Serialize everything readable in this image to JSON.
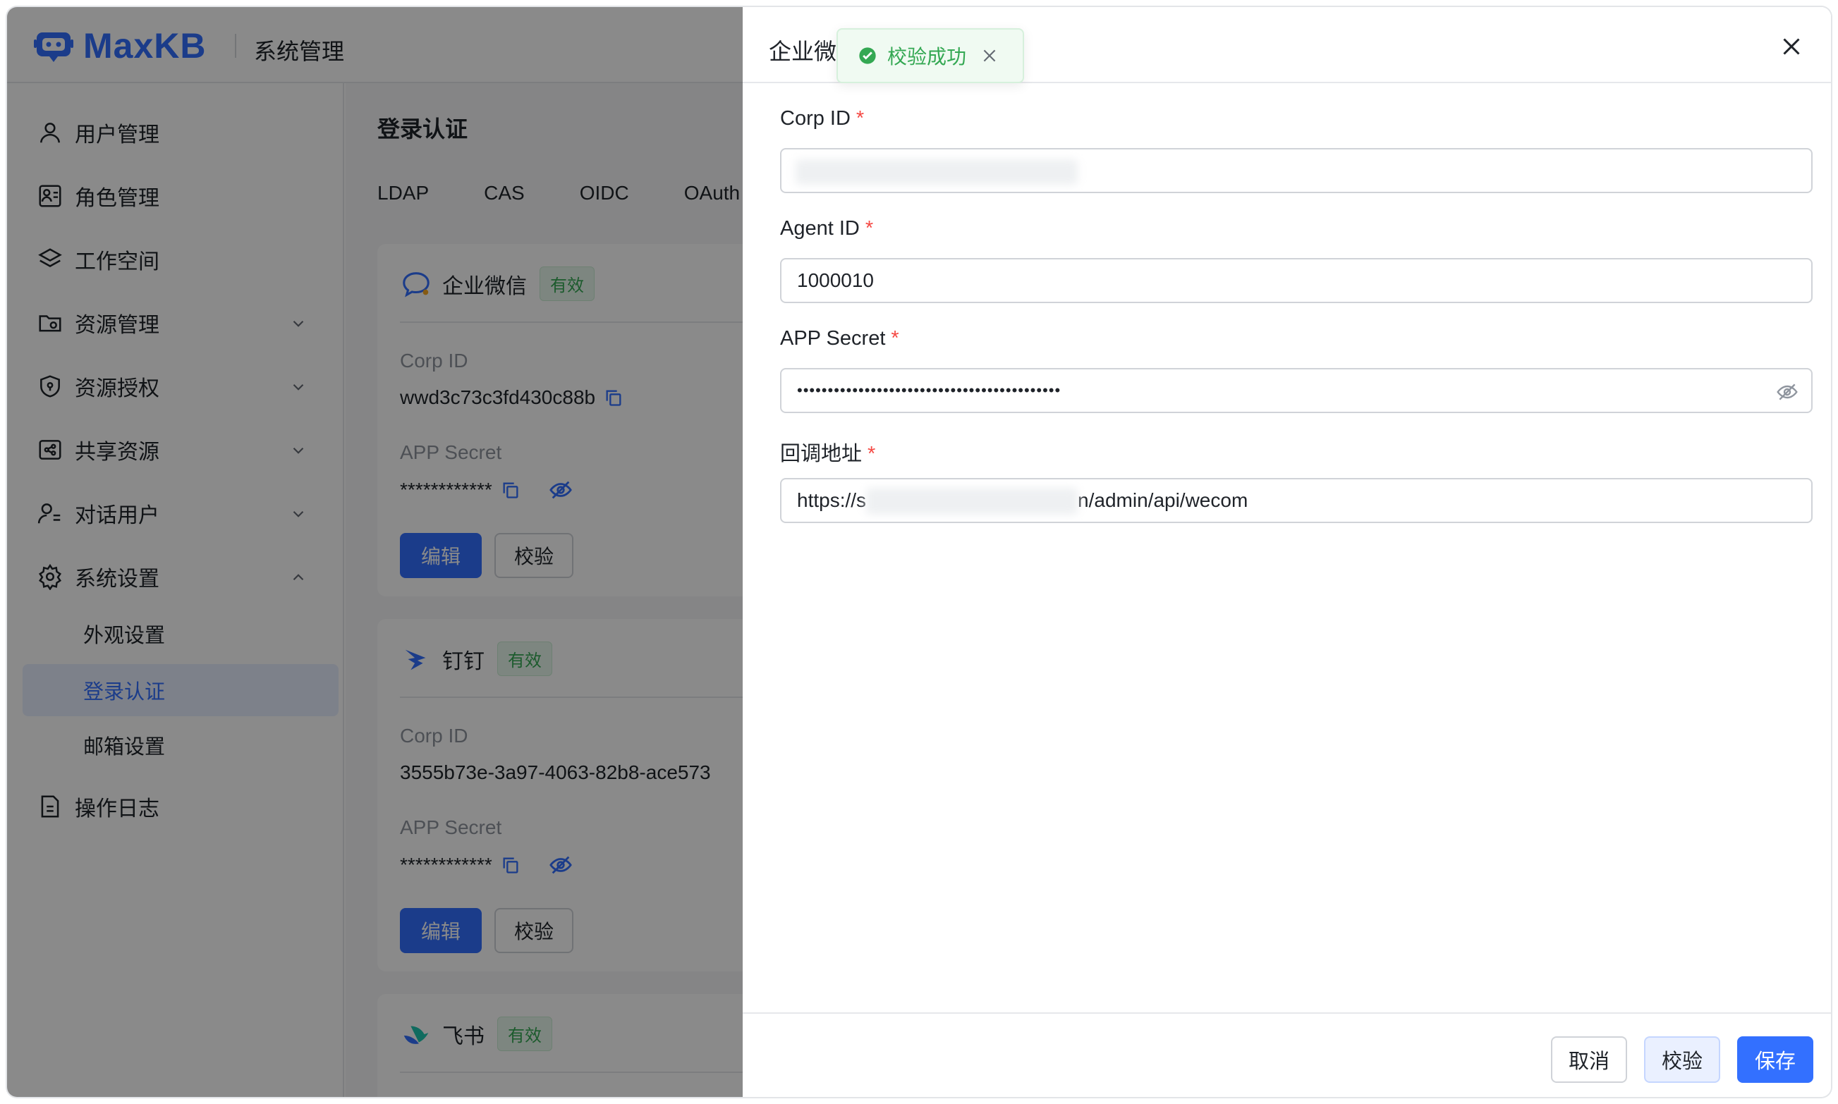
{
  "app": {
    "logo_text": "MaxKB",
    "section_title": "系统管理"
  },
  "sidebar": {
    "items": [
      {
        "label": "用户管理"
      },
      {
        "label": "角色管理"
      },
      {
        "label": "工作空间"
      },
      {
        "label": "资源管理"
      },
      {
        "label": "资源授权"
      },
      {
        "label": "共享资源"
      },
      {
        "label": "对话用户"
      },
      {
        "label": "系统设置"
      },
      {
        "label": "操作日志"
      }
    ],
    "sub_items": [
      {
        "label": "外观设置"
      },
      {
        "label": "登录认证"
      },
      {
        "label": "邮箱设置"
      }
    ]
  },
  "main": {
    "page_title": "登录认证",
    "tabs": [
      "LDAP",
      "CAS",
      "OIDC",
      "OAuth"
    ],
    "cards": [
      {
        "name": "企业微信",
        "badge": "有效",
        "corp_id_label": "Corp ID",
        "corp_id_value": "wwd3c73c3fd430c88b",
        "secret_label": "APP Secret",
        "secret_value": "************",
        "edit_label": "编辑",
        "verify_label": "校验"
      },
      {
        "name": "钉钉",
        "badge": "有效",
        "corp_id_label": "Corp ID",
        "corp_id_value": "3555b73e-3a97-4063-82b8-ace573",
        "secret_label": "APP Secret",
        "secret_value": "************",
        "edit_label": "编辑",
        "verify_label": "校验"
      },
      {
        "name": "飞书",
        "badge": "有效"
      }
    ]
  },
  "drawer": {
    "title": "企业微信设置",
    "fields": [
      {
        "label": "Corp ID",
        "required": "*",
        "value": ""
      },
      {
        "label": "Agent ID",
        "required": "*",
        "value": "1000010"
      },
      {
        "label": "APP Secret",
        "required": "*",
        "value": "•••••••••••••••••••••••••••••••••••••••••••"
      },
      {
        "label": "回调地址",
        "required": "*",
        "value_prefix": "https://s",
        "value_suffix": "n/admin/api/wecom"
      }
    ],
    "buttons": {
      "cancel": "取消",
      "verify": "校验",
      "save": "保存"
    }
  },
  "toast": {
    "message": "校验成功"
  },
  "colors": {
    "primary": "#3370ff",
    "success": "#34a853",
    "required": "#f54a45"
  }
}
